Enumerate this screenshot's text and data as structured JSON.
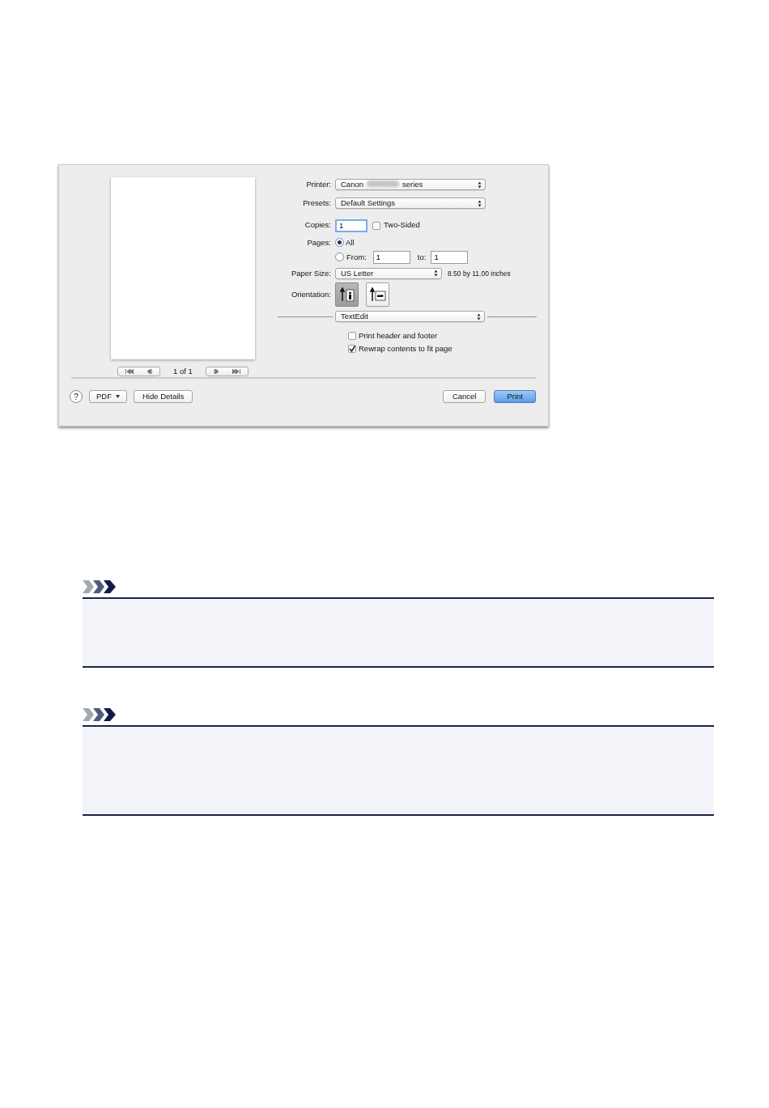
{
  "dialog": {
    "preview": {
      "page_indicator": "1 of 1"
    },
    "printer": {
      "label": "Printer:",
      "value_start": "Canon",
      "value_end": "series"
    },
    "presets": {
      "label": "Presets:",
      "value": "Default Settings"
    },
    "copies": {
      "label": "Copies:",
      "value": "1",
      "two_sided": {
        "label": "Two-Sided",
        "checked": false
      }
    },
    "pages": {
      "label": "Pages:",
      "options": [
        {
          "label": "All",
          "selected": true
        },
        {
          "label": "From:",
          "selected": false
        }
      ],
      "from": "1",
      "to_label": "to:",
      "to": "1"
    },
    "paper_size": {
      "label": "Paper Size:",
      "value": "US Letter",
      "dimensions": "8.50 by 11.00 inches"
    },
    "orientation": {
      "label": "Orientation:",
      "options": [
        {
          "kind": "portrait",
          "selected": true
        },
        {
          "kind": "landscape",
          "selected": false
        }
      ]
    },
    "app_section": {
      "value": "TextEdit",
      "options": [
        {
          "label": "Print header and footer",
          "checked": false
        },
        {
          "label": "Rewrap contents to fit page",
          "checked": true
        }
      ]
    },
    "footer": {
      "help": "?",
      "pdf": "PDF",
      "hide_details": "Hide Details",
      "cancel": "Cancel",
      "print": "Print"
    }
  },
  "notes": [
    {
      "kind": "note"
    },
    {
      "kind": "note"
    }
  ]
}
